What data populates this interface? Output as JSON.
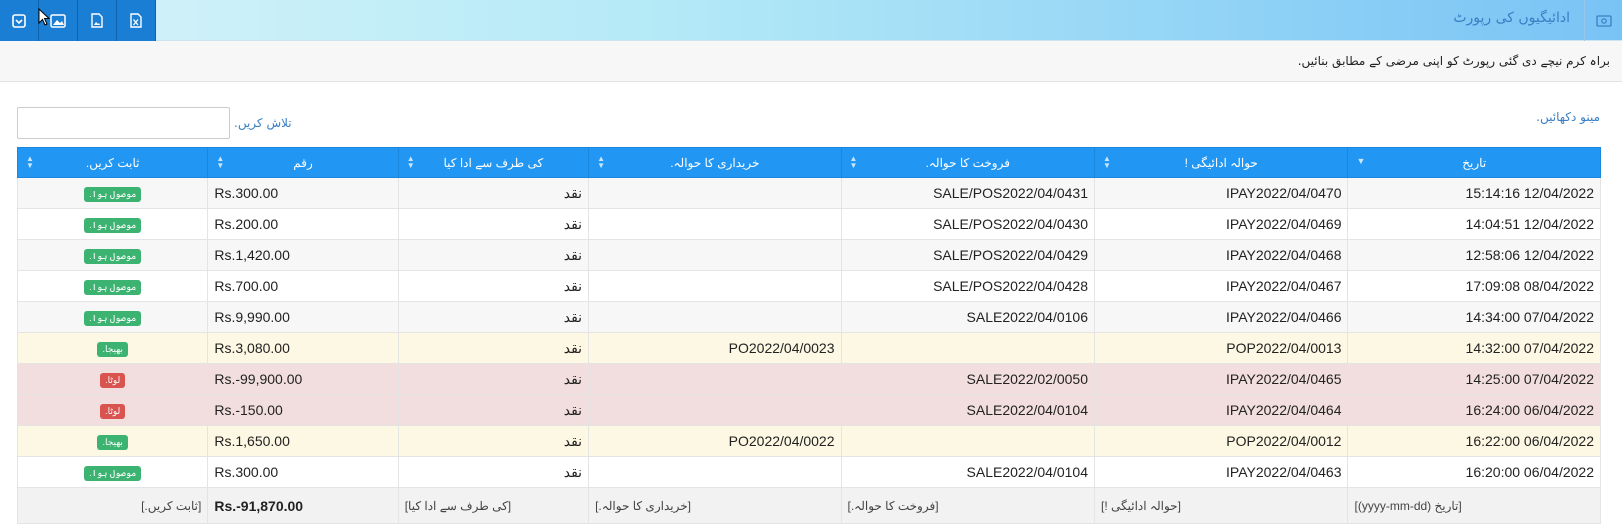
{
  "toolbar": {
    "buttons": [
      {
        "name": "archive-icon"
      },
      {
        "name": "image-gallery-icon"
      },
      {
        "name": "image-icon"
      },
      {
        "name": "excel-icon"
      }
    ]
  },
  "page": {
    "title": "ادائیگیوں کی رپورٹ",
    "subtitle": "براہ کرم نیچے دی گئی رپورٹ کو اپنی مرضی کے مطابق بنائیں.",
    "show_menu": "مینو دکھائیں.",
    "search_label": "تلاش کریں.",
    "search_value": ""
  },
  "table": {
    "headers": [
      "تاریخ",
      "حوالہ ادائیگی !",
      "فروخت کا حوالہ.",
      "خریداری کا حوالہ.",
      "کی طرف سے ادا کیا",
      "رقم",
      "ثابت کریں."
    ],
    "rows": [
      {
        "date": "15:14:16 12/04/2022",
        "payment_ref": "IPAY2022/04/0470",
        "sale_ref": "SALE/POS2022/04/0431",
        "purchase_ref": "",
        "paid_by": "نقد",
        "amount": "Rs.300.00",
        "status": "موصول ہوا.",
        "kind": "ok"
      },
      {
        "date": "14:04:51 12/04/2022",
        "payment_ref": "IPAY2022/04/0469",
        "sale_ref": "SALE/POS2022/04/0430",
        "purchase_ref": "",
        "paid_by": "نقد",
        "amount": "Rs.200.00",
        "status": "موصول ہوا.",
        "kind": "ok"
      },
      {
        "date": "12:58:06 12/04/2022",
        "payment_ref": "IPAY2022/04/0468",
        "sale_ref": "SALE/POS2022/04/0429",
        "purchase_ref": "",
        "paid_by": "نقد",
        "amount": "Rs.1,420.00",
        "status": "موصول ہوا.",
        "kind": "ok"
      },
      {
        "date": "17:09:08 08/04/2022",
        "payment_ref": "IPAY2022/04/0467",
        "sale_ref": "SALE/POS2022/04/0428",
        "purchase_ref": "",
        "paid_by": "نقد",
        "amount": "Rs.700.00",
        "status": "موصول ہوا.",
        "kind": "ok"
      },
      {
        "date": "14:34:00 07/04/2022",
        "payment_ref": "IPAY2022/04/0466",
        "sale_ref": "SALE2022/04/0106",
        "purchase_ref": "",
        "paid_by": "نقد",
        "amount": "Rs.9,990.00",
        "status": "موصول ہوا.",
        "kind": "ok"
      },
      {
        "date": "14:32:00 07/04/2022",
        "payment_ref": "POP2022/04/0013",
        "sale_ref": "",
        "purchase_ref": "PO2022/04/0023",
        "paid_by": "نقد",
        "amount": "Rs.3,080.00",
        "status": "بھیجا.",
        "kind": "sent"
      },
      {
        "date": "14:25:00 07/04/2022",
        "payment_ref": "IPAY2022/04/0465",
        "sale_ref": "SALE2022/02/0050",
        "purchase_ref": "",
        "paid_by": "نقد",
        "amount": "Rs.-99,900.00",
        "status": "لوٹا.",
        "kind": "ret"
      },
      {
        "date": "16:24:00 06/04/2022",
        "payment_ref": "IPAY2022/04/0464",
        "sale_ref": "SALE2022/04/0104",
        "purchase_ref": "",
        "paid_by": "نقد",
        "amount": "Rs.-150.00",
        "status": "لوٹا.",
        "kind": "ret"
      },
      {
        "date": "16:22:00 06/04/2022",
        "payment_ref": "POP2022/04/0012",
        "sale_ref": "",
        "purchase_ref": "PO2022/04/0022",
        "paid_by": "نقد",
        "amount": "Rs.1,650.00",
        "status": "بھیجا.",
        "kind": "sent"
      },
      {
        "date": "16:20:00 06/04/2022",
        "payment_ref": "IPAY2022/04/0463",
        "sale_ref": "SALE2022/04/0104",
        "purchase_ref": "",
        "paid_by": "نقد",
        "amount": "Rs.300.00",
        "status": "موصول ہوا.",
        "kind": "ok"
      }
    ],
    "footer": {
      "date": "[تاریخ (yyyy-mm-dd)]",
      "payment_ref": "[حوالہ ادائیگی !]",
      "sale_ref": "[فروخت کا حوالہ.]",
      "purchase_ref": "[خریداری کا حوالہ.]",
      "paid_by": "[کی طرف سے ادا کیا]",
      "amount": "Rs.-91,870.00",
      "status": "[ثابت کریں.]"
    }
  }
}
